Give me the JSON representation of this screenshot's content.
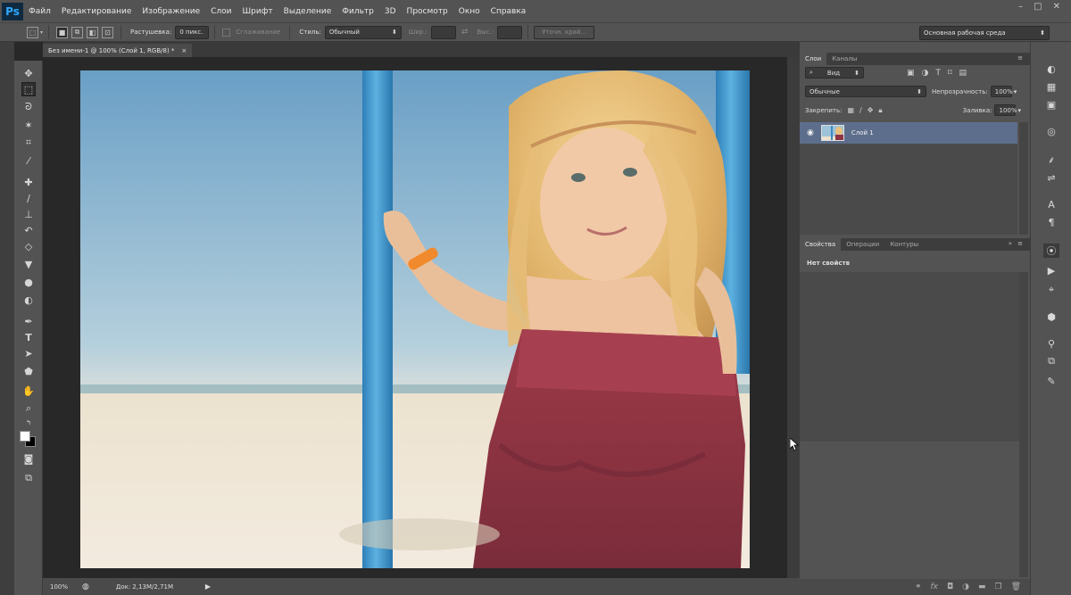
{
  "app": {
    "logo": "Ps",
    "menu": [
      "Файл",
      "Редактирование",
      "Изображение",
      "Слои",
      "Шрифт",
      "Выделение",
      "Фильтр",
      "3D",
      "Просмотр",
      "Окно",
      "Справка"
    ],
    "window_controls": [
      "–",
      "□",
      "✕"
    ]
  },
  "options_bar": {
    "feather_label": "Растушевка:",
    "feather_value": "0 пикс.",
    "antialias_label": "Сглаживание",
    "style_label": "Стиль:",
    "style_value": "Обычный",
    "width_label": "Шир.:",
    "height_label": "Выс.:",
    "refine_edge_button": "Уточн. край...",
    "workspace": "Основная рабочая среда"
  },
  "document": {
    "tab_title": "Без имени-1 @ 100% (Слой 1, RGB/8) *",
    "tab_close": "×"
  },
  "status_bar": {
    "zoom": "100%",
    "doc_size": "Док: 2,13M/2,71M"
  },
  "layers_panel": {
    "tabs": [
      "Слои",
      "Каналы"
    ],
    "filter_value": "Вид",
    "blend_mode": "Обычные",
    "opacity_label": "Непрозрачность:",
    "opacity_value": "100%",
    "lock_label": "Закрепить:",
    "fill_label": "Заливка:",
    "fill_value": "100%",
    "layers": [
      {
        "name": "Слой 1",
        "visible": true,
        "selected": true
      }
    ]
  },
  "properties_panel": {
    "tabs": [
      "Свойства",
      "Операции",
      "Контуры"
    ],
    "empty_message": "Нет свойств"
  },
  "tools": [
    "move-icon",
    "marquee-icon",
    "lasso-icon",
    "magic-wand-icon",
    "crop-icon",
    "eyedropper-icon",
    "healing-brush-icon",
    "brush-icon",
    "clone-stamp-icon",
    "history-brush-icon",
    "eraser-icon",
    "paint-bucket-icon",
    "blur-icon",
    "dodge-icon",
    "pen-icon",
    "type-icon",
    "path-selection-icon",
    "shape-icon",
    "hand-icon",
    "zoom-icon",
    "quick-mask-icon",
    "screen-mode-icon"
  ],
  "colors": {
    "foreground": "#ffffff",
    "background": "#000000",
    "selected_layer": "#5d6e8c"
  }
}
